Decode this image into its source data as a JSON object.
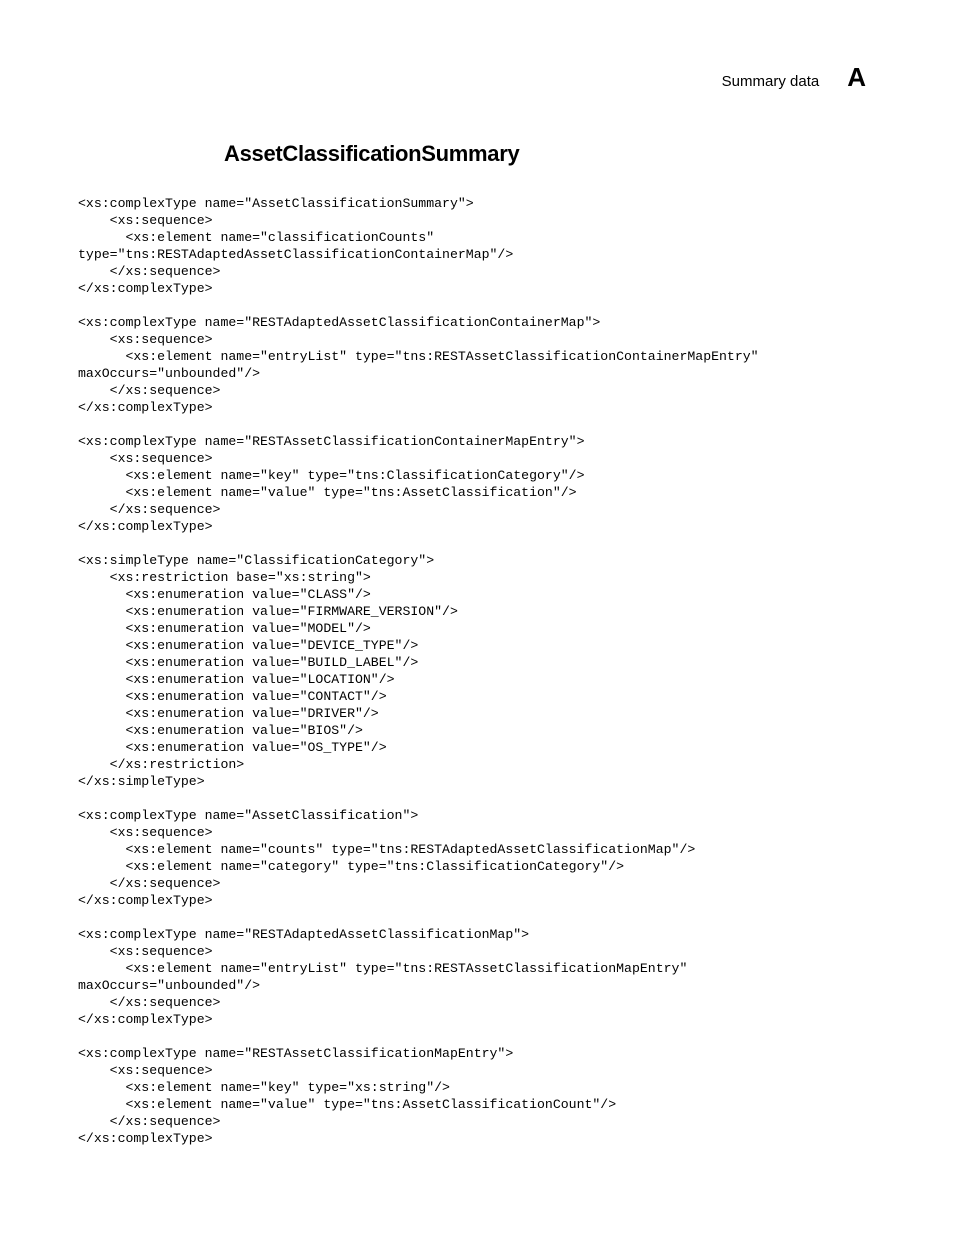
{
  "header": {
    "label": "Summary data",
    "letter": "A"
  },
  "section": {
    "title": "AssetClassificationSummary"
  },
  "code": "<xs:complexType name=\"AssetClassificationSummary\">\n    <xs:sequence>\n      <xs:element name=\"classificationCounts\" \ntype=\"tns:RESTAdaptedAssetClassificationContainerMap\"/>\n    </xs:sequence>\n</xs:complexType>\n\n<xs:complexType name=\"RESTAdaptedAssetClassificationContainerMap\">\n    <xs:sequence>\n      <xs:element name=\"entryList\" type=\"tns:RESTAssetClassificationContainerMapEntry\" \nmaxOccurs=\"unbounded\"/>\n    </xs:sequence>\n</xs:complexType>\n\n<xs:complexType name=\"RESTAssetClassificationContainerMapEntry\">\n    <xs:sequence>\n      <xs:element name=\"key\" type=\"tns:ClassificationCategory\"/>\n      <xs:element name=\"value\" type=\"tns:AssetClassification\"/>\n    </xs:sequence>\n</xs:complexType>\n\n<xs:simpleType name=\"ClassificationCategory\">\n    <xs:restriction base=\"xs:string\">\n      <xs:enumeration value=\"CLASS\"/>\n      <xs:enumeration value=\"FIRMWARE_VERSION\"/>\n      <xs:enumeration value=\"MODEL\"/>\n      <xs:enumeration value=\"DEVICE_TYPE\"/>\n      <xs:enumeration value=\"BUILD_LABEL\"/>\n      <xs:enumeration value=\"LOCATION\"/>\n      <xs:enumeration value=\"CONTACT\"/>\n      <xs:enumeration value=\"DRIVER\"/>\n      <xs:enumeration value=\"BIOS\"/>\n      <xs:enumeration value=\"OS_TYPE\"/>\n    </xs:restriction>\n</xs:simpleType>\n\n<xs:complexType name=\"AssetClassification\">\n    <xs:sequence>\n      <xs:element name=\"counts\" type=\"tns:RESTAdaptedAssetClassificationMap\"/>\n      <xs:element name=\"category\" type=\"tns:ClassificationCategory\"/>\n    </xs:sequence>\n</xs:complexType>\n\n<xs:complexType name=\"RESTAdaptedAssetClassificationMap\">\n    <xs:sequence>\n      <xs:element name=\"entryList\" type=\"tns:RESTAssetClassificationMapEntry\" \nmaxOccurs=\"unbounded\"/>\n    </xs:sequence>\n</xs:complexType>\n\n<xs:complexType name=\"RESTAssetClassificationMapEntry\">\n    <xs:sequence>\n      <xs:element name=\"key\" type=\"xs:string\"/>\n      <xs:element name=\"value\" type=\"tns:AssetClassificationCount\"/>\n    </xs:sequence>\n</xs:complexType>"
}
